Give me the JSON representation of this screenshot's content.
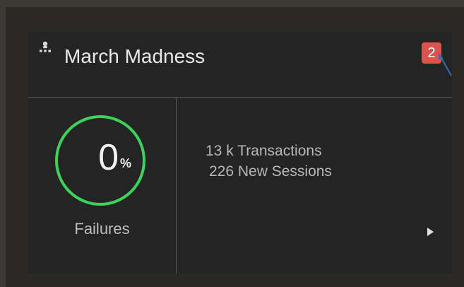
{
  "card": {
    "title": "March Madness",
    "badge_count": "2",
    "failure_value": "0",
    "failure_unit": "%",
    "failure_label": "Failures",
    "transactions": "13 k Transactions",
    "new_sessions": "226 New Sessions",
    "icons": {
      "group": "group-icon",
      "expand": "expand-arrow-icon"
    },
    "colors": {
      "badge": "#d9534f",
      "ring": "#3cd35c",
      "card_bg": "#242424"
    }
  }
}
